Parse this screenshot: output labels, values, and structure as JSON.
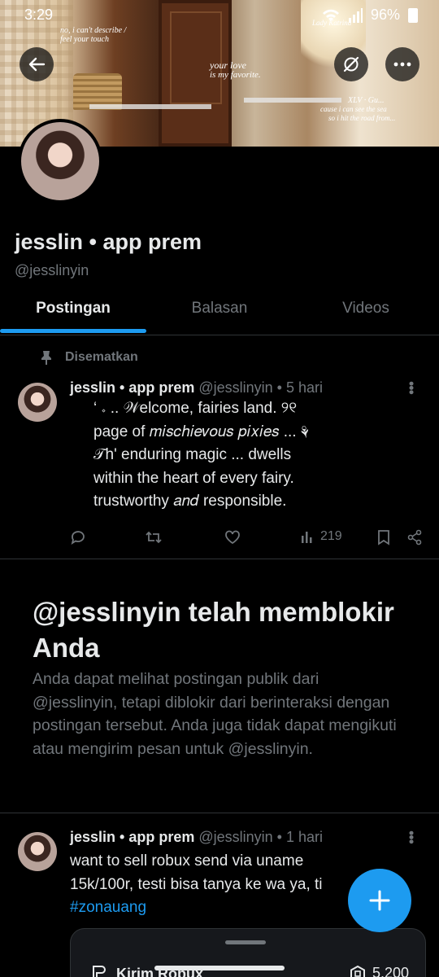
{
  "status_bar": {
    "time": "3:29",
    "battery": "96%"
  },
  "banner_text": {
    "left": "no, i can't describe / feel your touch",
    "center_1": "your love",
    "center_2": "is my favorite.",
    "right_1": "XLV · Gu...",
    "right_2": "cause i can see the sea",
    "right_3": "so i hit the road from...",
    "top_right": "Lady Katrina"
  },
  "profile": {
    "name": "jesslin • app prem",
    "handle": "@jesslinyin"
  },
  "tabs": [
    {
      "label": "Postingan",
      "active": true
    },
    {
      "label": "Balasan",
      "active": false
    },
    {
      "label": "Videos",
      "active": false
    }
  ],
  "pinned": {
    "label": "Disematkan",
    "author": "jesslin • app prem",
    "meta": "@jesslinyin • 5 hari",
    "text_lines": [
      "‘ 𝆹 .. 𝒲elcome, fairies land. ୨୧",
      "page of 𝑚𝑖𝑠𝑐ℎ𝑖𝑒𝑣𝑜𝑢𝑠 𝑝𝑖𝑥𝑖𝑒𝑠 ... ⚘",
      "𝒯h' enduring magic ... dwells",
      "within the heart of every fairy.",
      "trustworthy 𝑎𝑛𝑑 responsible."
    ],
    "views": "219"
  },
  "blocked": {
    "title": "@jesslinyin telah memblokir Anda",
    "description": "Anda dapat melihat postingan publik dari @jesslinyin, tetapi diblokir dari berinteraksi dengan postingan tersebut. Anda juga tidak dapat mengikuti atau mengirim pesan untuk @jesslinyin."
  },
  "tweet2": {
    "author": "jesslin • app prem",
    "meta": "@jesslinyin • 1 hari",
    "text": "want to sell robux send via uname 15k/100r, testi bisa tanya ke wa ya, ti",
    "hashtag": "#zonauang"
  },
  "sheet": {
    "item": "Kirim Robux",
    "price": "5.200"
  },
  "colors": {
    "accent": "#1d9bf0",
    "background": "#000000",
    "secondary_text": "#71767b"
  }
}
